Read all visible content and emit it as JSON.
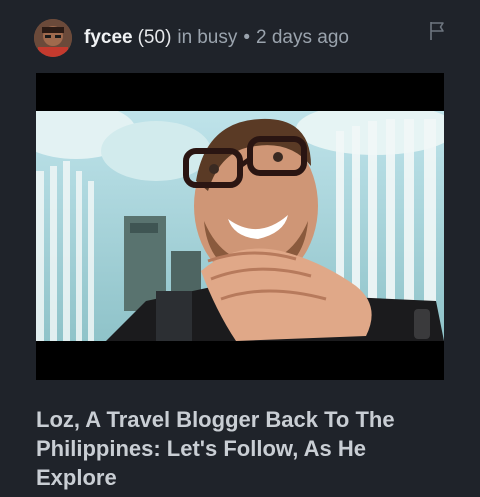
{
  "post": {
    "author": {
      "name": "fycee",
      "reputation": "(50)"
    },
    "meta": {
      "in_label": "in",
      "community": "busy",
      "separator": "•",
      "time_ago": "2 days ago"
    },
    "flag_icon": "flag-icon",
    "title": "Loz, A Travel Blogger Back To The Philippines: Let's Follow, As He Explore"
  },
  "colors": {
    "background": "#1f232a",
    "title": "#c9ced4",
    "meta": "#9aa3ad"
  }
}
